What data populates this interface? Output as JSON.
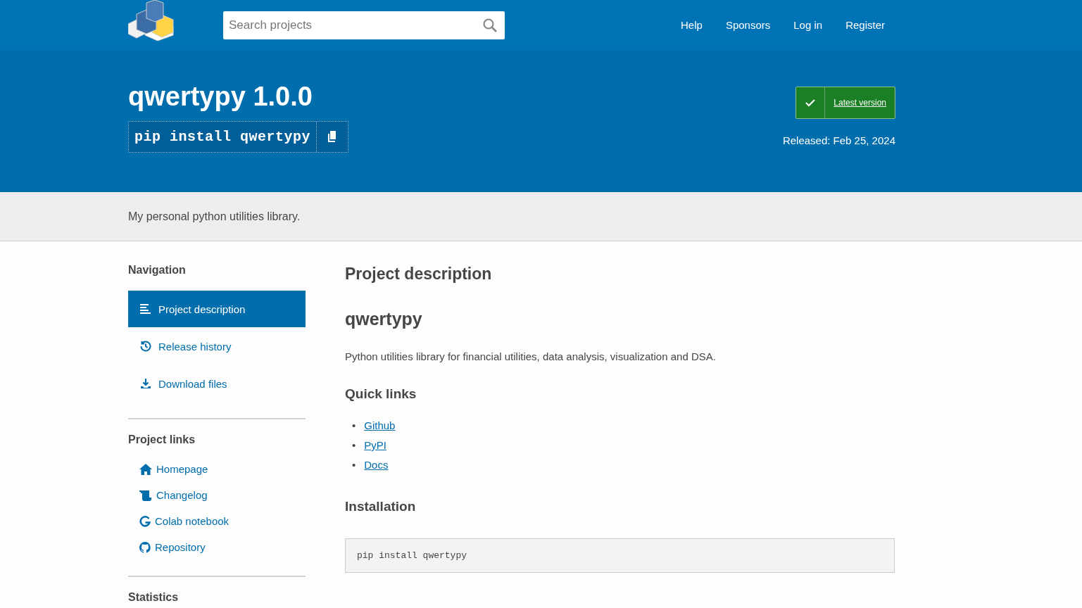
{
  "header": {
    "search": {
      "placeholder": "Search projects"
    },
    "nav": [
      "Help",
      "Sponsors",
      "Log in",
      "Register"
    ]
  },
  "hero": {
    "title": "qwertypy 1.0.0",
    "pip_command": "pip install qwertypy",
    "latest_badge": {
      "label": "Latest version",
      "latest": true
    },
    "released": "Released: Feb 25, 2024"
  },
  "summary": "My personal python utilities library.",
  "sidebar": {
    "navigation": {
      "heading": "Navigation",
      "items": [
        {
          "label": "Project description",
          "kind": "description",
          "selected": true
        },
        {
          "label": "Release history",
          "kind": "history",
          "selected": false
        },
        {
          "label": "Download files",
          "kind": "download",
          "selected": false
        }
      ]
    },
    "project_links": {
      "heading": "Project links",
      "items": [
        {
          "label": "Homepage",
          "kind": "home"
        },
        {
          "label": "Changelog",
          "kind": "scroll"
        },
        {
          "label": "Colab notebook",
          "kind": "google"
        },
        {
          "label": "Repository",
          "kind": "github"
        }
      ]
    },
    "statistics": {
      "heading": "Statistics"
    }
  },
  "content": {
    "heading": "Project description",
    "project_name": "qwertypy",
    "intro": "Python utilities library for financial utilities, data analysis, visualization and DSA.",
    "quick_links": {
      "heading": "Quick links",
      "links": [
        {
          "bullet": "•",
          "label": "Github"
        },
        {
          "bullet": "•",
          "label": "PyPI"
        },
        {
          "bullet": "•",
          "label": "Docs"
        }
      ]
    },
    "installation": {
      "heading": "Installation",
      "code": "pip install qwertypy"
    }
  }
}
